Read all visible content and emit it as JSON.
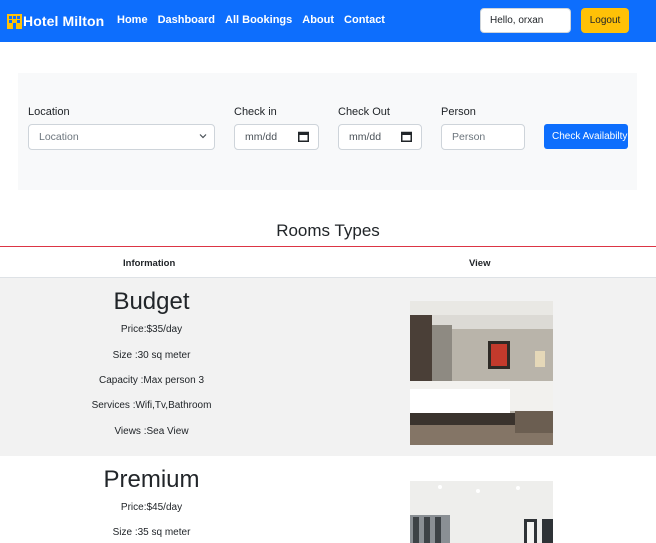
{
  "navbar": {
    "brand": "Hotel Milton",
    "links": [
      "Home",
      "Dashboard",
      "All Bookings",
      "About",
      "Contact"
    ],
    "greeting": "Hello, orxan",
    "logout_label": "Logout",
    "color": "#0d6efd"
  },
  "search": {
    "location_label": "Location",
    "location_selected": "Location",
    "checkin_label": "Check in",
    "checkin_placeholder": "mm/dd",
    "checkout_label": "Check Out",
    "checkout_placeholder": "mm/dd",
    "person_label": "Person",
    "person_placeholder": "Person",
    "button_label": "Check Availabilty"
  },
  "rooms_section": {
    "title": "Rooms Types",
    "columns": [
      "Information",
      "View"
    ]
  },
  "rooms": [
    {
      "name": "Budget",
      "price": "Price:$35/day",
      "size": "Size :30 sq meter",
      "capacity": "Capacity :Max person 3",
      "services": "Services :Wifi,Tv,Bathroom",
      "views": "Views :Sea View"
    },
    {
      "name": "Premium",
      "price": "Price:$45/day",
      "size": "Size :35 sq meter"
    }
  ],
  "colors": {
    "primary": "#0d6efd",
    "warning": "#ffc107",
    "danger": "#dc3545"
  }
}
